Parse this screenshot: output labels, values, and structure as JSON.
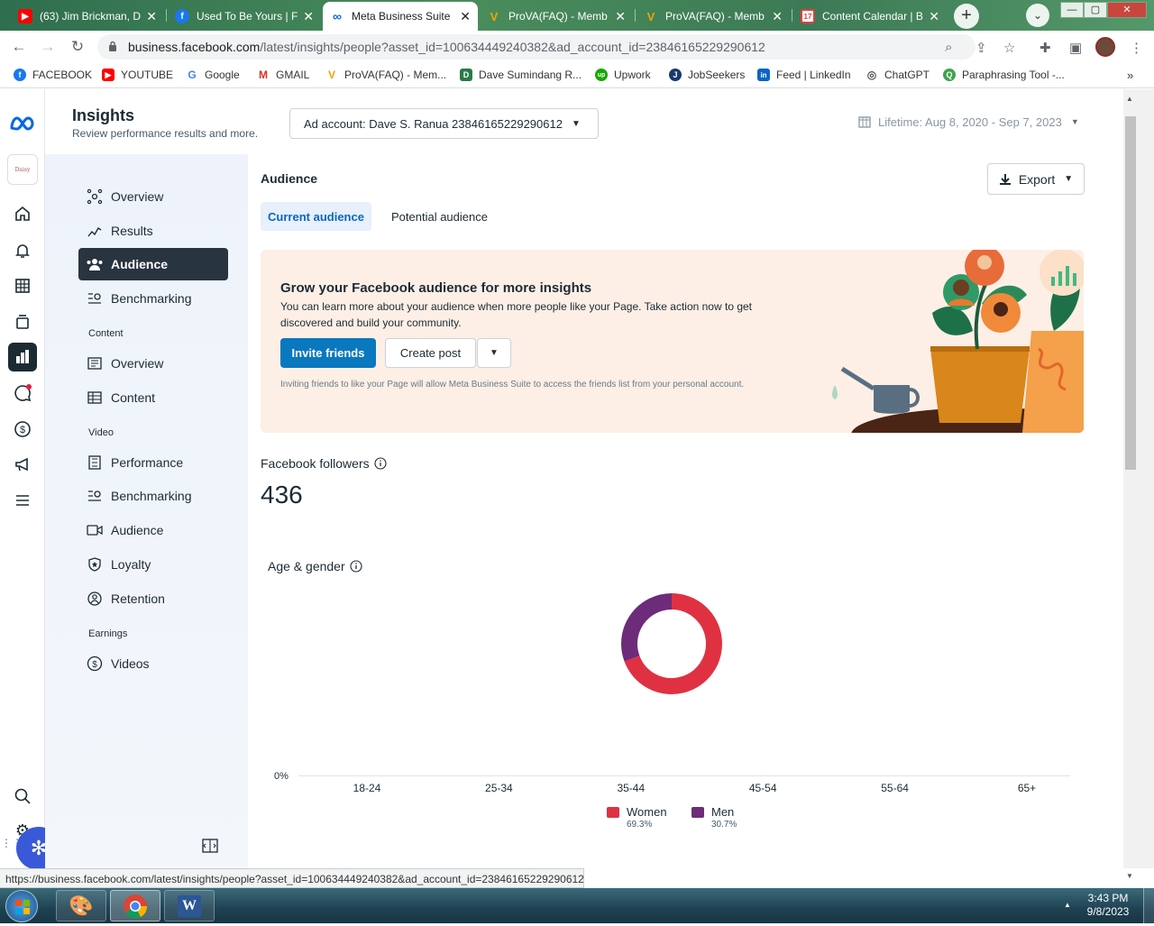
{
  "browser": {
    "tabs": [
      {
        "title": "(63) Jim Brickman, D",
        "icon": "youtube-icon",
        "color": "#ff0000"
      },
      {
        "title": "Used To Be Yours | Fa",
        "icon": "facebook-icon",
        "color": "#1877f2"
      },
      {
        "title": "Meta Business Suite",
        "icon": "meta-icon",
        "color": "#0668e1",
        "active": true
      },
      {
        "title": "ProVA(FAQ) - Memb",
        "icon": "prova-icon",
        "color": "#f4a300"
      },
      {
        "title": "ProVA(FAQ) - Memb",
        "icon": "prova-icon",
        "color": "#f4a300"
      },
      {
        "title": "Content Calendar | B",
        "icon": "calendar-icon",
        "color": "#e04040"
      }
    ],
    "url_host": "business.facebook.com",
    "url_path": "/latest/insights/people?asset_id=100634449240382&ad_account_id=23846165229290612",
    "bookmarks": [
      {
        "label": "FACEBOOK",
        "color": "#1877f2",
        "glyph": "f"
      },
      {
        "label": "YOUTUBE",
        "color": "#ff0000",
        "glyph": "▶"
      },
      {
        "label": "Google",
        "color": "#4285f4",
        "glyph": "G"
      },
      {
        "label": "GMAIL",
        "color": "#d93025",
        "glyph": "M"
      },
      {
        "label": "ProVA(FAQ) - Mem...",
        "color": "#f4a300",
        "glyph": "V"
      },
      {
        "label": "Dave Sumindang R...",
        "color": "#2a7a4a",
        "glyph": "D"
      },
      {
        "label": "Upwork",
        "color": "#14a800",
        "glyph": "up"
      },
      {
        "label": "JobSeekers",
        "color": "#1a3a6a",
        "glyph": "J"
      },
      {
        "label": "Feed | LinkedIn",
        "color": "#0a66c2",
        "glyph": "in"
      },
      {
        "label": "ChatGPT",
        "color": "#74aa9c",
        "glyph": "◎"
      },
      {
        "label": "Paraphrasing Tool -...",
        "color": "#3fa34d",
        "glyph": "Q"
      }
    ],
    "status_url": "https://business.facebook.com/latest/insights/people?asset_id=100634449240382&ad_account_id=23846165229290612"
  },
  "header": {
    "title": "Insights",
    "subtitle": "Review performance results and more.",
    "ad_account": "Ad account: Dave S. Ranua 23846165229290612",
    "date_range": "Lifetime: Aug 8, 2020 - Sep 7, 2023"
  },
  "sidenav": {
    "items": [
      {
        "label": "Overview",
        "icon": "overview-icon"
      },
      {
        "label": "Results",
        "icon": "results-icon"
      },
      {
        "label": "Audience",
        "icon": "audience-icon",
        "active": true
      },
      {
        "label": "Benchmarking",
        "icon": "benchmarking-icon"
      }
    ],
    "content_section": "Content",
    "content_items": [
      {
        "label": "Overview",
        "icon": "content-overview-icon"
      },
      {
        "label": "Content",
        "icon": "content-table-icon"
      }
    ],
    "video_section": "Video",
    "video_items": [
      {
        "label": "Performance",
        "icon": "performance-icon"
      },
      {
        "label": "Benchmarking",
        "icon": "video-benchmarking-icon"
      },
      {
        "label": "Audience",
        "icon": "video-audience-icon"
      },
      {
        "label": "Loyalty",
        "icon": "loyalty-icon"
      },
      {
        "label": "Retention",
        "icon": "retention-icon"
      }
    ],
    "earnings_section": "Earnings",
    "earnings_items": [
      {
        "label": "Videos",
        "icon": "dollar-icon"
      }
    ]
  },
  "main": {
    "section_title": "Audience",
    "export_label": "Export",
    "tabs": [
      {
        "label": "Current audience",
        "active": true
      },
      {
        "label": "Potential audience"
      }
    ],
    "banner": {
      "title": "Grow your Facebook audience for more insights",
      "body": "You can learn more about your audience when more people like your Page. Take action now to get discovered and build your community.",
      "invite": "Invite friends",
      "create_post": "Create post",
      "note": "Inviting friends to like your Page will allow Meta Business Suite to access the friends list from your personal account."
    },
    "followers_label": "Facebook followers",
    "followers_count": "436",
    "age_gender_label": "Age & gender",
    "axis_zero": "0%"
  },
  "chart_data": {
    "type": "pie",
    "donut": true,
    "series": [
      {
        "name": "Women",
        "value": 69.3,
        "label": "69.3%",
        "color": "#e03142"
      },
      {
        "name": "Men",
        "value": 30.7,
        "label": "30.7%",
        "color": "#6e2b7a"
      }
    ],
    "categories": [
      "18-24",
      "25-34",
      "35-44",
      "45-54",
      "55-64",
      "65+"
    ],
    "ylabel_zero": "0%"
  },
  "taskbar": {
    "time": "3:43 PM",
    "date": "9/8/2023"
  }
}
